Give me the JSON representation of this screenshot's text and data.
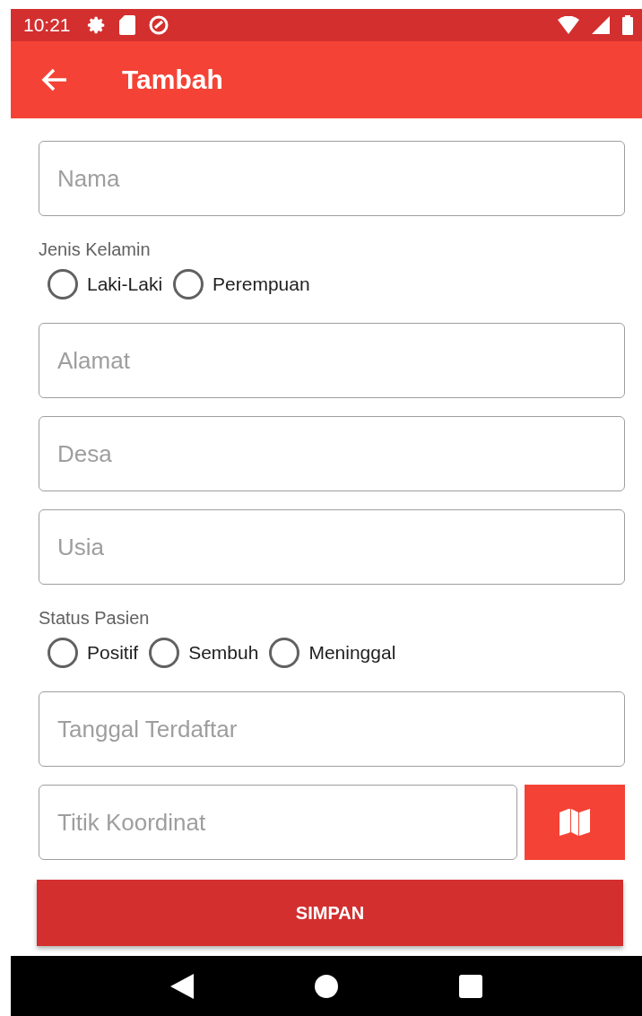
{
  "status_bar": {
    "time": "10:21"
  },
  "app_bar": {
    "title": "Tambah"
  },
  "form": [
    {
      "kind": "text",
      "placeholder": "Nama"
    },
    {
      "kind": "radio",
      "label": "Jenis Kelamin",
      "options": [
        {
          "label": "Laki-Laki",
          "selected": false
        },
        {
          "label": "Perempuan",
          "selected": false
        }
      ]
    },
    {
      "kind": "text",
      "placeholder": "Alamat"
    },
    {
      "kind": "text",
      "placeholder": "Desa"
    },
    {
      "kind": "text",
      "placeholder": "Usia"
    },
    {
      "kind": "radio",
      "label": "Status Pasien",
      "options": [
        {
          "label": "Positif",
          "selected": false
        },
        {
          "label": "Sembuh",
          "selected": false
        },
        {
          "label": "Meninggal",
          "selected": false
        }
      ]
    },
    {
      "kind": "text",
      "placeholder": "Tanggal Terdaftar"
    },
    {
      "kind": "map",
      "placeholder": "Titik Koordinat"
    }
  ],
  "submit": "SIMPAN"
}
